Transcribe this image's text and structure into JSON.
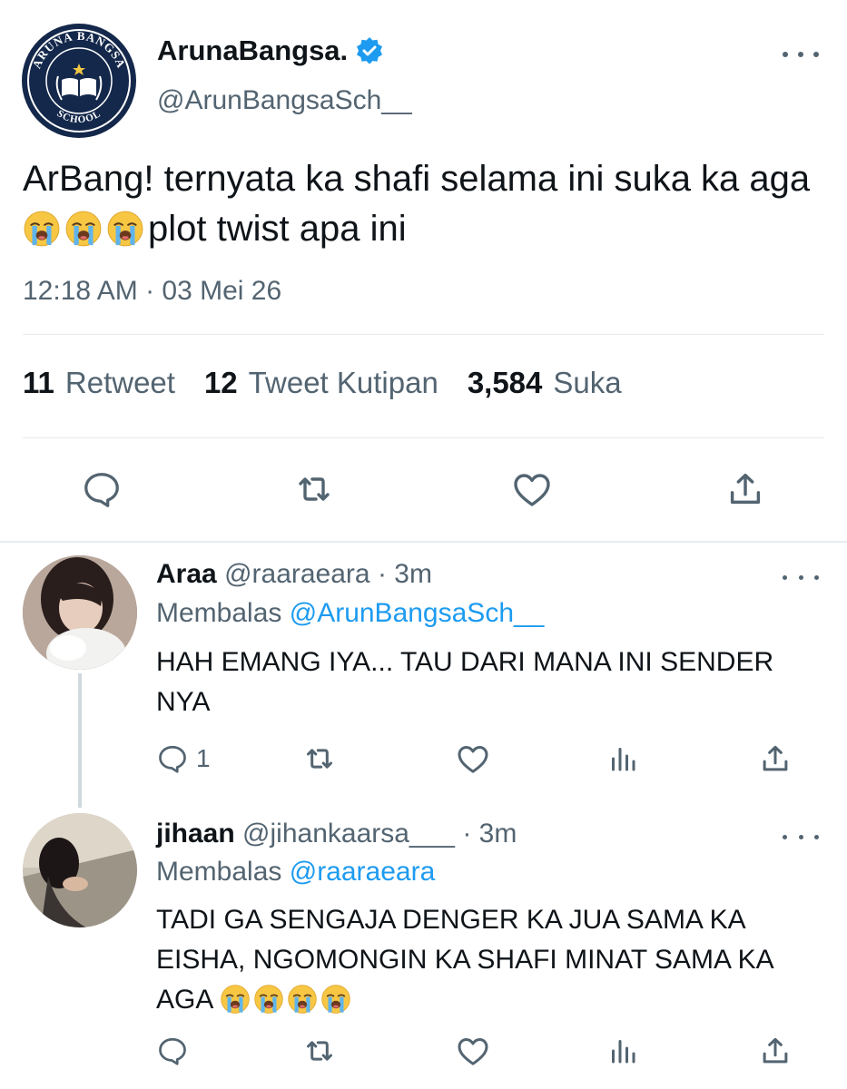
{
  "main_tweet": {
    "author": {
      "name": "ArunaBangsa.",
      "handle": "@ArunBangsaSch__",
      "verified": true,
      "avatar": {
        "top_text": "ARUNA BANGSA",
        "bottom_text": "SCHOOL",
        "colors": {
          "background": "#14284b",
          "foreground": "#ffffff",
          "star": "#f2c744"
        }
      }
    },
    "text_part1": "ArBang! ternyata ka shafi selama ini suka ka aga",
    "text_emojis": [
      "crying-face-emoji",
      "crying-face-emoji",
      "crying-face-emoji"
    ],
    "text_part2": "plot twist apa ini",
    "timestamp": "12:18 AM · 03 Mei 26",
    "stats": [
      {
        "count": "11",
        "label": "Retweet"
      },
      {
        "count": "12",
        "label": "Tweet Kutipan"
      },
      {
        "count": "3,584",
        "label": "Suka"
      }
    ],
    "actions": [
      "reply-icon",
      "retweet-icon",
      "like-icon",
      "share-icon"
    ]
  },
  "replies": [
    {
      "name": "Araa",
      "handle": "@raaraeara",
      "time": "· 3m",
      "replying_label": "Membalas",
      "replying_to": "@ArunBangsaSch__",
      "text": "HAH EMANG IYA... TAU DARI MANA INI SENDER NYA",
      "emojis": [],
      "reply_count": "1"
    },
    {
      "name": "jihaan",
      "handle": "@jihankaarsa___",
      "time": "· 3m",
      "replying_label": "Membalas",
      "replying_to": "@raaraeara",
      "text": "TADI GA SENGAJA DENGER KA JUA SAMA KA EISHA, NGOMONGIN KA SHAFI MINAT SAMA KA AGA",
      "emojis": [
        "crying-face-emoji",
        "crying-face-emoji",
        "crying-face-emoji",
        "crying-face-emoji"
      ],
      "reply_count": ""
    }
  ],
  "colors": {
    "text_primary": "#0f1419",
    "text_secondary": "#536471",
    "accent": "#1d9bf0",
    "divider": "#e6ecf0"
  }
}
